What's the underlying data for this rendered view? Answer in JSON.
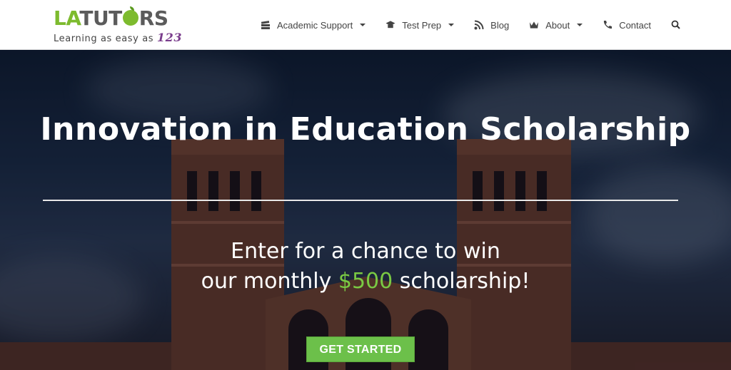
{
  "logo": {
    "la": "LA",
    "tut": "TUT",
    "rs": "RS",
    "tagline": "Learning as easy as ",
    "tagline_num": "123"
  },
  "nav": {
    "items": [
      {
        "label": "Academic Support",
        "icon": "books-icon",
        "dropdown": true
      },
      {
        "label": "Test Prep",
        "icon": "graduation-cap-icon",
        "dropdown": true
      },
      {
        "label": "Blog",
        "icon": "rss-icon",
        "dropdown": false
      },
      {
        "label": "About",
        "icon": "crown-icon",
        "dropdown": true
      },
      {
        "label": "Contact",
        "icon": "phone-icon",
        "dropdown": false
      }
    ],
    "search_icon": "search-icon"
  },
  "hero": {
    "title": "Innovation in Education Scholarship",
    "line1": "Enter for a chance to win",
    "line2_pre": "our monthly ",
    "line2_amount": "$500",
    "line2_post": " scholarship!",
    "cta": "GET STARTED"
  },
  "colors": {
    "brand_green": "#7dbb2e",
    "cta_green": "#6cc04a",
    "amount_green": "#7ac943",
    "purple": "#7a3d8c"
  }
}
